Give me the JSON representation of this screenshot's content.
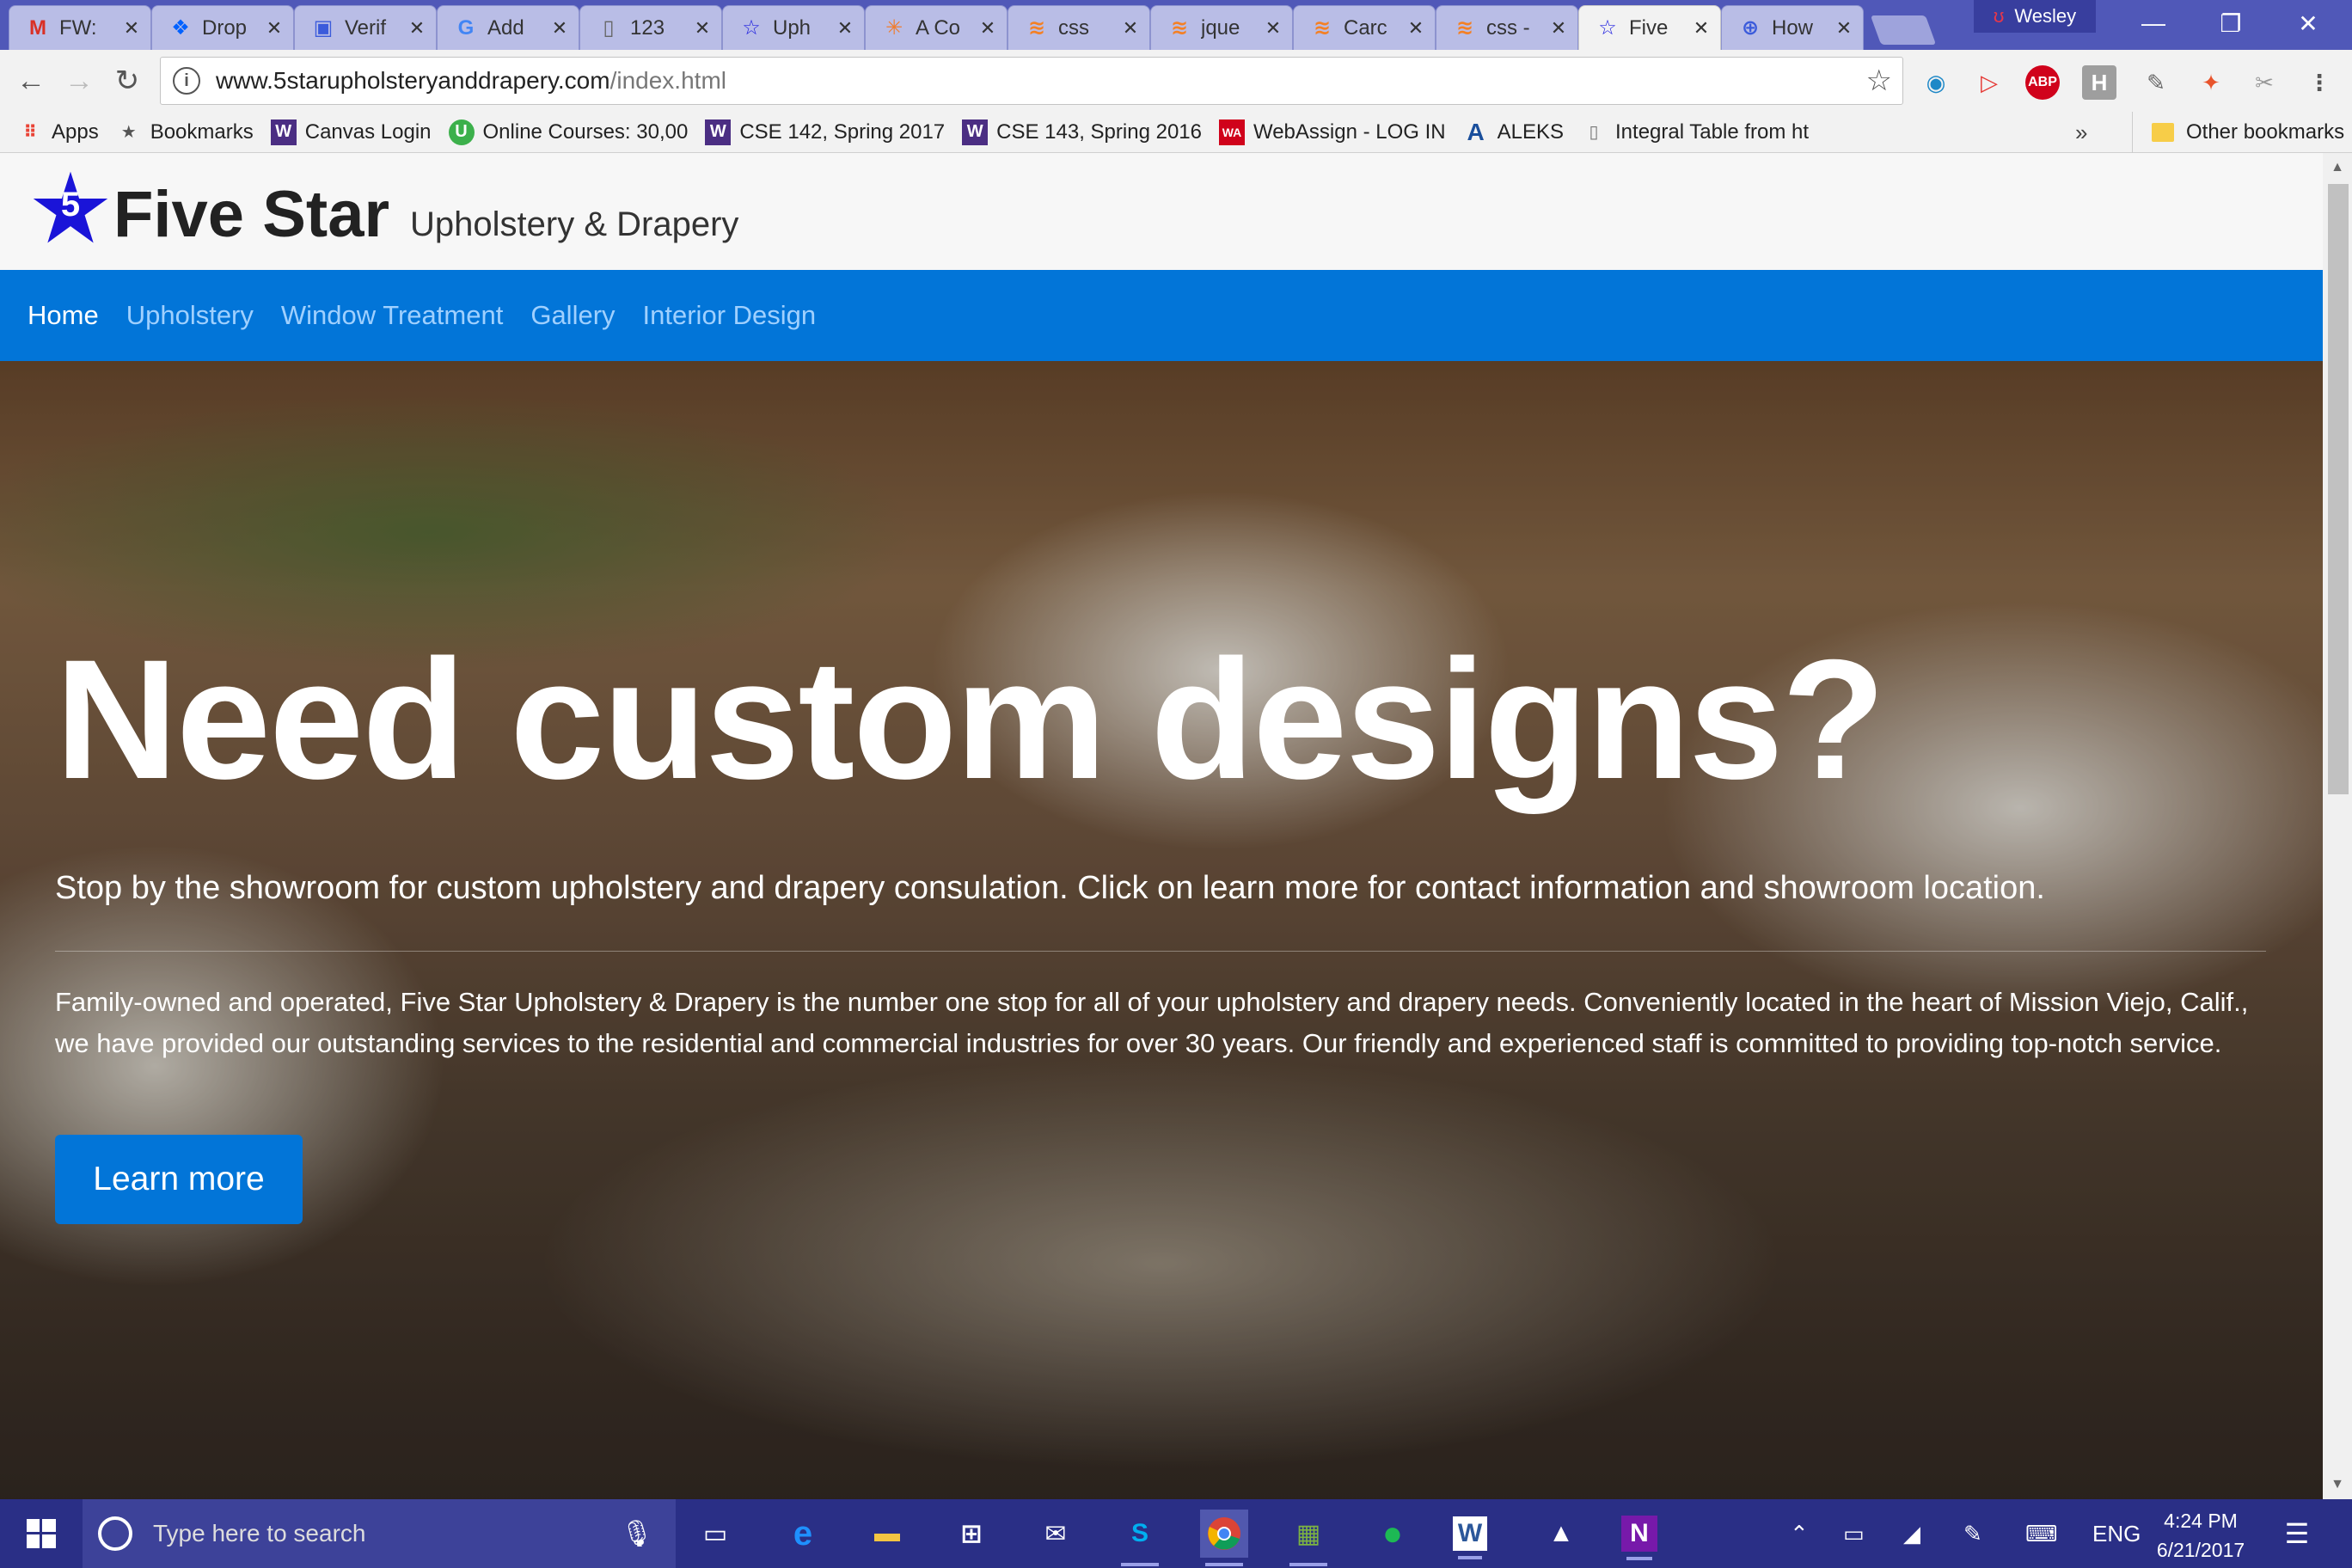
{
  "browser": {
    "tabs": [
      {
        "label": "FW:",
        "icon": "gmail-icon",
        "active": false
      },
      {
        "label": "Drop",
        "icon": "dropbox-icon",
        "active": false
      },
      {
        "label": "Verif",
        "icon": "verify-icon",
        "active": false
      },
      {
        "label": "Add",
        "icon": "google-icon",
        "active": false
      },
      {
        "label": "123",
        "icon": "document-icon",
        "active": false
      },
      {
        "label": "Uph",
        "icon": "star-icon",
        "active": false
      },
      {
        "label": "A Co",
        "icon": "asterisk-icon",
        "active": false
      },
      {
        "label": "css",
        "icon": "stackoverflow-icon",
        "active": false
      },
      {
        "label": "jque",
        "icon": "stackoverflow-icon",
        "active": false
      },
      {
        "label": "Carc",
        "icon": "stackoverflow-icon",
        "active": false
      },
      {
        "label": "css -",
        "icon": "stackoverflow-icon",
        "active": false
      },
      {
        "label": "Five",
        "icon": "star-icon",
        "active": true
      },
      {
        "label": "How",
        "icon": "search-icon",
        "active": false
      }
    ],
    "profile_name": "Wesley",
    "url_host": "www.5starupholsteryanddrapery.com",
    "url_path": "/index.html",
    "bookmarks": [
      {
        "label": "Apps",
        "icon": "apps-grid-icon",
        "color": "#e94235"
      },
      {
        "label": "Bookmarks",
        "icon": "star-icon",
        "color": "#555555"
      },
      {
        "label": "Canvas Login",
        "icon": "uw-icon",
        "color": "#4b2e83"
      },
      {
        "label": "Online Courses: 30,00",
        "icon": "udemy-icon",
        "color": "#3cb04b"
      },
      {
        "label": "CSE 142, Spring 2017",
        "icon": "uw-icon",
        "color": "#4b2e83"
      },
      {
        "label": "CSE 143, Spring 2016",
        "icon": "uw-icon",
        "color": "#4b2e83"
      },
      {
        "label": "WebAssign - LOG IN",
        "icon": "webassign-icon",
        "color": "#d0021b"
      },
      {
        "label": "ALEKS",
        "icon": "aleks-icon",
        "color": "#1a4f9c"
      },
      {
        "label": "Integral Table from ht",
        "icon": "document-icon",
        "color": "#777777"
      }
    ],
    "bookmarks_overflow": "»",
    "other_bookmarks": "Other bookmarks"
  },
  "site": {
    "logo_number": "5",
    "brand_name": "Five Star",
    "brand_sub": "Upholstery & Drapery",
    "nav": [
      "Home",
      "Upholstery",
      "Window Treatment",
      "Gallery",
      "Interior Design"
    ],
    "hero_title": "Need custom designs?",
    "hero_lead": "Stop by the showroom for custom upholstery and drapery consulation. Click on learn more for contact information and showroom location.",
    "hero_body": "Family-owned and operated, Five Star Upholstery & Drapery is the number one stop for all of your upholstery and drapery needs. Conveniently located in the heart of Mission Viejo, Calif., we have provided our outstanding services to the residential and commercial industries for over 30 years. Our friendly and experienced staff is committed to providing top-notch service.",
    "cta_label": "Learn more",
    "accent_color": "#0275d8"
  },
  "taskbar": {
    "search_placeholder": "Type here to search",
    "language": "ENG",
    "time": "4:24 PM",
    "date": "6/21/2017"
  }
}
